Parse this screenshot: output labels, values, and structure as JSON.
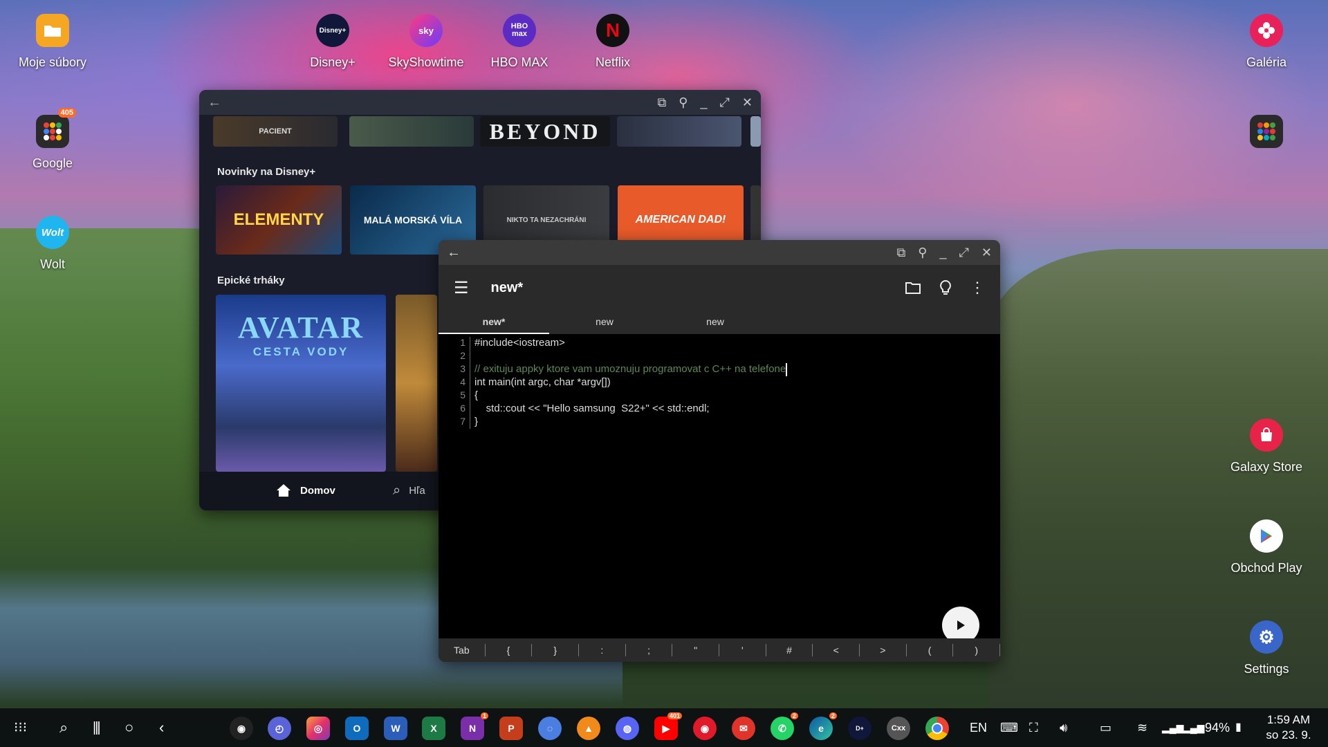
{
  "desktop": {
    "left_icons": [
      {
        "label": "Moje súbory",
        "icon": "folder-icon"
      },
      {
        "label": "Google",
        "icon": "apps-folder-icon",
        "badge": "405"
      },
      {
        "label": "Wolt",
        "icon": "wolt-icon",
        "icon_text": "Wolt"
      }
    ],
    "top_icons": [
      {
        "label": "Disney+",
        "icon_text": "Disney+"
      },
      {
        "label": "SkyShowtime",
        "icon_text": "sky"
      },
      {
        "label": "HBO MAX",
        "icon_text": "HBO max"
      },
      {
        "label": "Netflix",
        "icon_text": "N"
      }
    ],
    "right_icons": [
      {
        "label": "Galéria",
        "icon": "flower-icon"
      },
      {
        "label": "",
        "icon": "apps-folder-icon"
      },
      {
        "label": "Galaxy Store",
        "icon": "bag-icon"
      },
      {
        "label": "Obchod Play",
        "icon": "play-store-icon"
      },
      {
        "label": "Settings",
        "icon": "gear-icon"
      }
    ]
  },
  "disney_window": {
    "rows": [
      {
        "label": "",
        "tiles": [
          "PACIENT",
          "",
          "BEYOND",
          ""
        ]
      },
      {
        "label": "Novinky na Disney+",
        "tiles": [
          "ELEMENTY",
          "MALÁ MORSKÁ VÍLA",
          "NIKTO TA NEZACHRÁNI",
          "AMERICAN DAD!"
        ]
      },
      {
        "label": "Epické trháky",
        "tiles": [
          "AVATAR",
          "CESTA VODY"
        ]
      }
    ],
    "nav": {
      "home": "Domov",
      "search": "Hľa"
    }
  },
  "editor_window": {
    "title": "new*",
    "tabs": [
      "new*",
      "new",
      "new"
    ],
    "code_lines": [
      {
        "n": "1",
        "text": "#include<iostream>"
      },
      {
        "n": "2",
        "text": ""
      },
      {
        "n": "3",
        "text": "// exituju appky ktore vam umoznuju programovat c C++ na telefone"
      },
      {
        "n": "4",
        "text": "int main(int argc, char *argv[])"
      },
      {
        "n": "5",
        "text": "{"
      },
      {
        "n": "6",
        "text": "    std::cout << \"Hello samsung  S22+\" << std::endl;"
      },
      {
        "n": "7",
        "text": "}"
      }
    ],
    "keys": [
      "Tab",
      "{",
      "}",
      ":",
      ";",
      "\"",
      "'",
      "#",
      "<",
      ">",
      "(",
      ")"
    ]
  },
  "taskbar": {
    "language": "EN",
    "battery": "94%",
    "time": "1:59 AM",
    "date": "so 23. 9.",
    "badges": {
      "onenote": "1",
      "youtube": "401",
      "whatsapp": "2",
      "edge": "2"
    }
  }
}
